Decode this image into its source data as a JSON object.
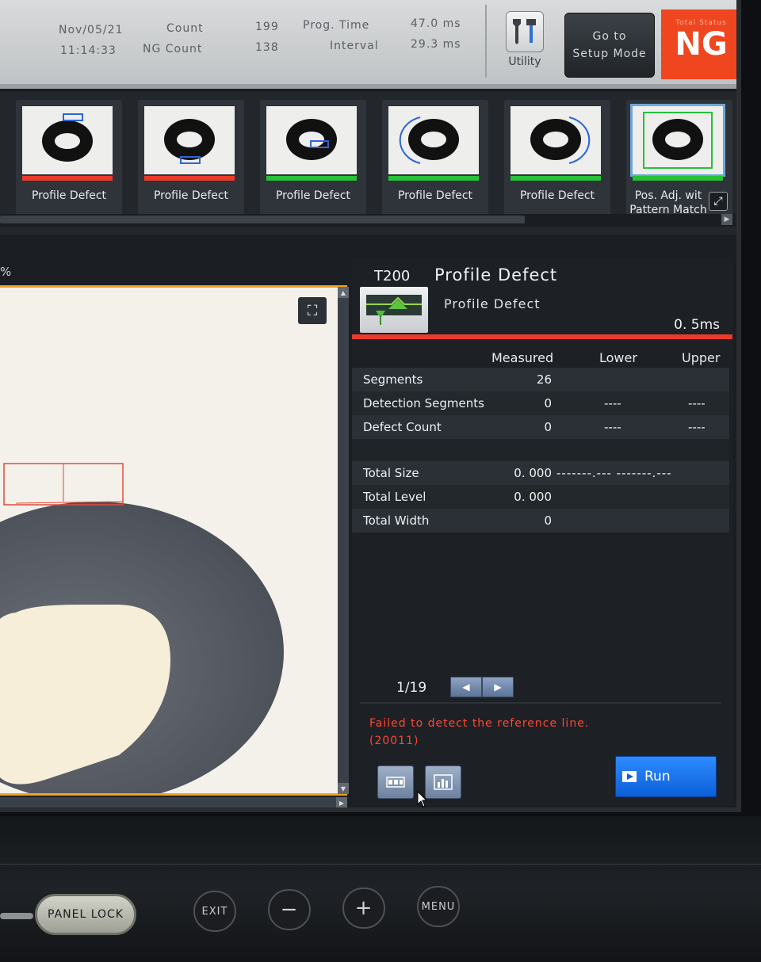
{
  "status": {
    "date": "Nov/05/21",
    "time": "11:14:33",
    "count_label": "Count",
    "count_value": "199",
    "ng_count_label": "NG Count",
    "ng_count_value": "138",
    "prog_time_label": "Prog. Time",
    "prog_time_value": "47.0 ms",
    "interval_label": "Interval",
    "interval_value": "29.3 ms",
    "utility_label": "Utility",
    "setup_line1": "Go to",
    "setup_line2": "Setup Mode",
    "total_status_label": "Total Status",
    "total_status_value": "NG",
    "ng_color": "#f0461f"
  },
  "tools": [
    {
      "label": "Profile Defect",
      "status": "ng",
      "status_color": "#ea3b2a"
    },
    {
      "label": "Profile Defect",
      "status": "ng",
      "status_color": "#ea3b2a"
    },
    {
      "label": "Profile Defect",
      "status": "ok",
      "status_color": "#27c13a"
    },
    {
      "label": "Profile Defect",
      "status": "ok",
      "status_color": "#27c13a"
    },
    {
      "label": "Profile Defect",
      "status": "ok",
      "status_color": "#27c13a"
    },
    {
      "label_line1": "Pos. Adj. wit",
      "label_line2": "Pattern Match",
      "status": "ok",
      "status_color": "#27c13a"
    }
  ],
  "image_view": {
    "zoom_label": "%"
  },
  "result": {
    "tool_id": "T200",
    "title": "Profile Defect",
    "subtitle": "Profile Defect",
    "proc_time": "0. 5ms",
    "columns": {
      "measured": "Measured",
      "lower": "Lower",
      "upper": "Upper"
    },
    "rows": [
      {
        "name": "Segments",
        "measured": "26",
        "lower": "",
        "upper": ""
      },
      {
        "name": "Detection Segments",
        "measured": "0",
        "lower": "----",
        "upper": "----"
      },
      {
        "name": "Defect Count",
        "measured": "0",
        "lower": "----",
        "upper": "----"
      }
    ],
    "rows2": [
      {
        "name": "Total Size",
        "measured": "0. 000",
        "range": "-------.--- -------.---"
      },
      {
        "name": "Total Level",
        "measured": "0. 000"
      },
      {
        "name": "Total Width",
        "measured": "0"
      }
    ],
    "pager": "1/19",
    "error_line1": "Failed to detect the reference line.",
    "error_line2": "(20011)",
    "run_label": "Run"
  },
  "bezel": {
    "panel_lock": "PANEL LOCK",
    "exit": "EXIT",
    "minus": "−",
    "plus": "+",
    "menu": "MENU"
  }
}
